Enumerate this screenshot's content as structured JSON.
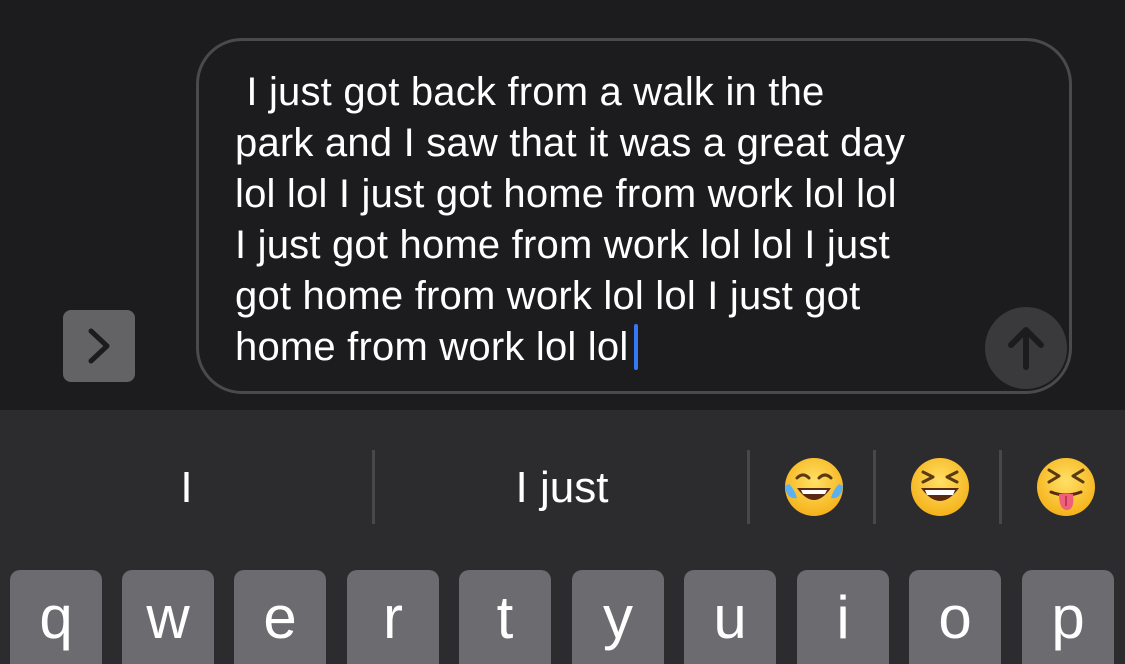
{
  "compose": {
    "message_text": " I just got back from a walk in the\npark and I saw that it was a great day\nlol lol I just got home from work lol lol\nI just got home from work lol lol I just\ngot home from work lol lol I just got\nhome from work lol lol",
    "expand_icon": "chevron-right-icon",
    "send_icon": "arrow-up-icon",
    "caret_color": "#3478f6"
  },
  "predictive": {
    "suggestion_1": "I",
    "suggestion_2": "I just",
    "emojis": [
      "face-with-tears-of-joy-emoji",
      "grinning-squinting-face-emoji",
      "squinting-face-with-tongue-emoji"
    ]
  },
  "keyboard": {
    "keys": [
      "q",
      "w",
      "e",
      "r",
      "t",
      "y",
      "u",
      "i",
      "o",
      "p"
    ]
  }
}
